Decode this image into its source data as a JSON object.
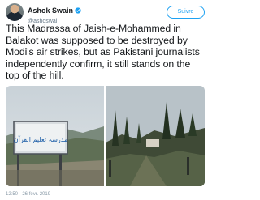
{
  "tweet": {
    "author": {
      "display_name": "Ashok Swain",
      "handle": "@ashoswai",
      "verified": true,
      "verified_icon": "verified-badge-icon",
      "verified_color": "#1da1f2"
    },
    "follow_button_label": "Suivre",
    "text": "This Madrassa of Jaish-e-Mohammed in\nBalakot was supposed to be destroyed by\nModi's air strikes, but as Pakistani journalists\nindependently confirm, it still stands on the\ntop of the hill.",
    "media": {
      "left_photo_sign_text": "مدرسہ تعلیم القرآن"
    },
    "timestamp": "12:50 - 26 févr. 2019"
  },
  "colors": {
    "accent": "#1da1f2",
    "text": "#14171a",
    "secondary_text": "#657786"
  }
}
